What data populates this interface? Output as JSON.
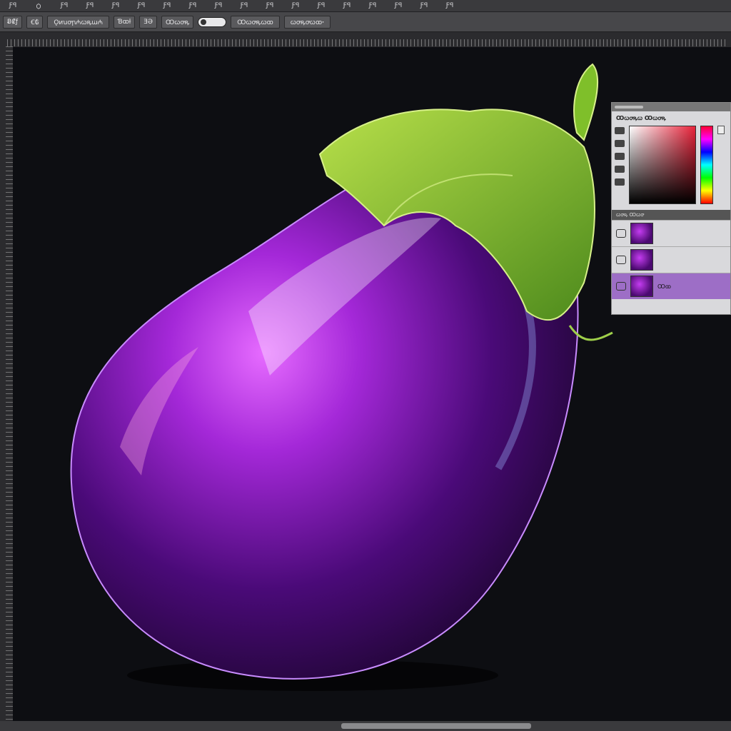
{
  "menubar": {
    "items": [
      "Ƒꟼ",
      "Ꟁ",
      "Ƒꟼ",
      "Ƒꟼ",
      "Ƒꟼ",
      "Ƒꟼ",
      "Ƒꟼ",
      "Ƒꟼ",
      "Ƒꟼ",
      "Ƒꟼ",
      "Ƒꟼ",
      "Ƒꟼ",
      "Ƒꟼ",
      "Ƒꟼ",
      "Ƒꟼ",
      "Ƒꟼ",
      "Ƒꟼ",
      "Ƒꟼ"
    ]
  },
  "options": {
    "tool_a": "Ƀ₡ƒ",
    "tool_b": "Ꞓ₲",
    "preset": "Ǫᴎꭒꝍꞃ₼ꞷꝶꭐ₼",
    "brush": "Ɓꝏƚ",
    "size": "ƎƏ",
    "mode": "Ꝏꞷꝍꝶ",
    "flow": "Ꝏꞷꝍꝶꞷꝏ",
    "opacity": "ꞷꝍꝶꝍꞷꝏꞏ"
  },
  "color_panel": {
    "title": "Ꝏꞷꝍꝶꞷ Ꝏꞷꝍꝶ",
    "accent": "#e8233a"
  },
  "layers_panel": {
    "title": "ꞷꝍꝶ Ꝏꞷꝍ",
    "rows": [
      {
        "label": ""
      },
      {
        "label": ""
      },
      {
        "label": "Ꝏꝏ"
      }
    ]
  },
  "colors": {
    "canvas_bg": "#0d0e12",
    "eggplant": "#7a1fb0",
    "leaf": "#7fbf2a",
    "active_layer": "#9d6ec6"
  }
}
